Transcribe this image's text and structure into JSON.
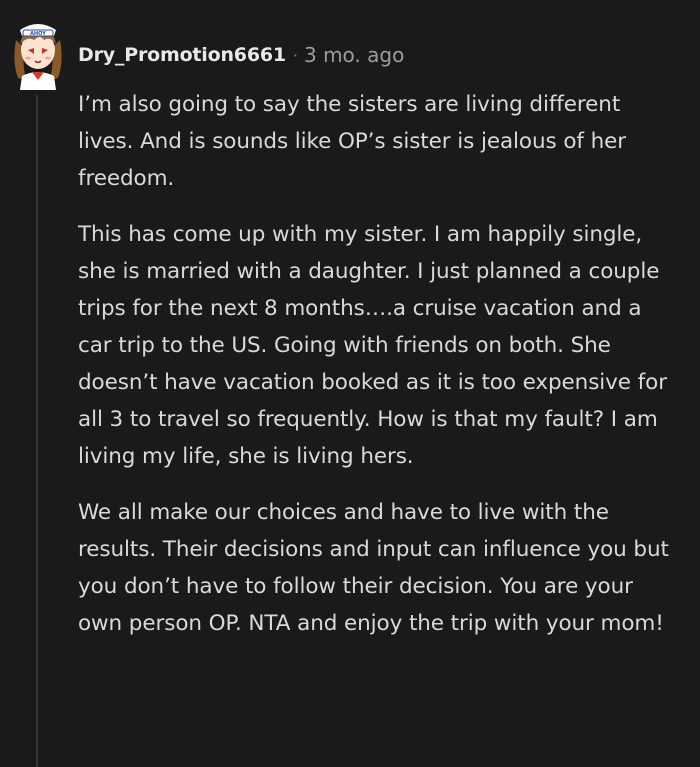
{
  "comment": {
    "avatar_icon": "sailor-avatar-icon",
    "avatar_hat_text": "AHOY",
    "username": "Dry_Promotion6661",
    "separator": "·",
    "timestamp": "3 mo. ago",
    "paragraphs": [
      "I’m also going to say the sisters are living different lives. And is sounds like OP’s sister is jealous of her freedom.",
      "This has come up with my sister. I am happily single, she is married with a daughter. I just planned a couple trips for the next 8 months….a cruise vacation and a car trip to the US. Going with friends on both. She doesn’t have vacation booked as it is too expensive for all 3 to travel so frequently. How is that my fault? I am living my life, she is living hers.",
      "We all make our choices and have to live with the results. Their decisions and input can influence you but you don’t have to follow their decision. You are your own person OP. NTA and enjoy the trip with your mom!"
    ]
  },
  "colors": {
    "background": "#1a1a1b",
    "text": "#d7dadc",
    "meta": "#9a9c9e",
    "thread_line": "#343536"
  }
}
